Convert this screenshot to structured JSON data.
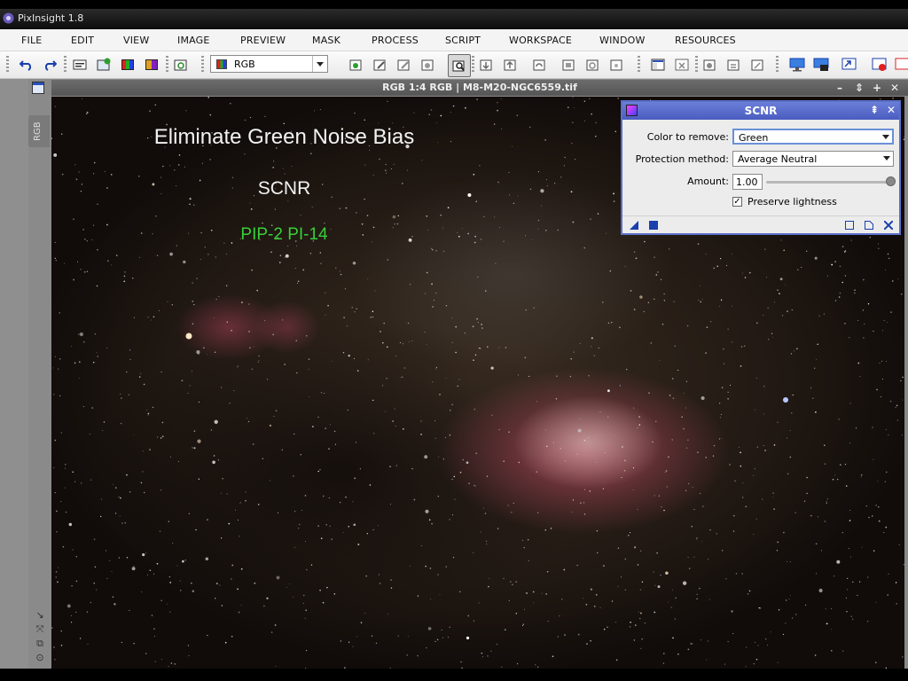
{
  "app": {
    "title": "PixInsight 1.8"
  },
  "menu": [
    "FILE",
    "EDIT",
    "VIEW",
    "IMAGE",
    "PREVIEW",
    "MASK",
    "PROCESS",
    "SCRIPT",
    "WORKSPACE",
    "WINDOW",
    "RESOURCES"
  ],
  "toolbar": {
    "channel_value": "RGB"
  },
  "image_window": {
    "title": "RGB 1:4 RGB | M8-M20-NGC6559.tif",
    "side_tab": "RGB"
  },
  "overlay": {
    "heading": "Eliminate Green Noise Bias",
    "subheading": "SCNR",
    "code": "PIP-2 PI-14"
  },
  "scnr": {
    "title": "SCNR",
    "color_label": "Color to remove:",
    "color_value": "Green",
    "protection_label": "Protection method:",
    "protection_value": "Average Neutral",
    "amount_label": "Amount:",
    "amount_value": "1.00",
    "amount_fraction": 1.0,
    "preserve_label": "Preserve lightness",
    "preserve_checked": true
  },
  "colors": {
    "dialog_header": "#5b6fc8",
    "code_text": "#38d038",
    "nebula": "#aa465a"
  }
}
